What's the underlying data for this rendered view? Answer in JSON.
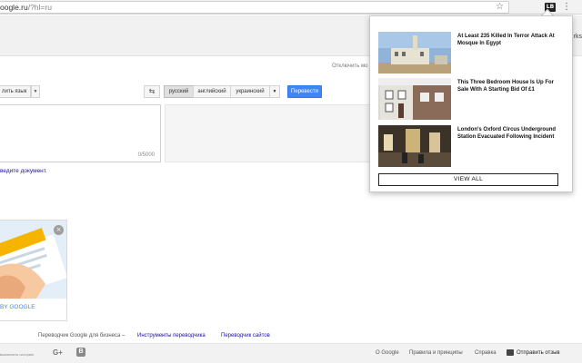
{
  "browser": {
    "url_host": "oogle.ru",
    "url_path": "/?hl=ru",
    "star_icon": "star-icon",
    "extension_icon_text": "LB",
    "menu_icon": "vertical-dots-icon",
    "bookmarks_label": "rks"
  },
  "translate": {
    "disable_link": "Отключить мо",
    "source_button": "лить язык",
    "swap_icon": "swap-arrows-icon",
    "target_languages": [
      "русский",
      "английский",
      "украинский"
    ],
    "translate_button": "Перевести",
    "counter": "0/5000",
    "document_link": "ведите документ."
  },
  "ad": {
    "label": "BY GOOGLE",
    "close_icon": "close-icon"
  },
  "business": {
    "text": "Переводчик Google для бизнеса –",
    "link1": "Инструменты переводчика",
    "link2": "Переводчик сайтов"
  },
  "footer": {
    "left_text": "выключить историю",
    "links": [
      "О Google",
      "Правила и принципы",
      "Справка"
    ],
    "feedback": "Отправить отзыв"
  },
  "popup": {
    "news": [
      {
        "title": "At Least 235 Killed In Terror Attack At Mosque In Egypt"
      },
      {
        "title": "This Three Bedroom House Is Up For Sale With A Starting Bid Of £1"
      },
      {
        "title": "London's Oxford Circus Underground Station Evacuated Following Incident"
      }
    ],
    "view_all": "VIEW ALL"
  },
  "colors": {
    "accent": "#4285f4",
    "link": "#1a0dab"
  }
}
